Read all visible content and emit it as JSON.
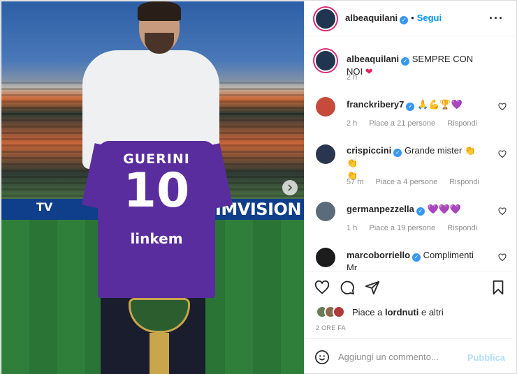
{
  "post": {
    "photo": {
      "shirt_name": "GUERINI",
      "shirt_number": "10",
      "shirt_sponsor": "linkem",
      "banner_text": "TIMVISION",
      "banner_tv": "TV",
      "carousel_next_icon": "chevron-right-icon"
    },
    "header": {
      "username": "albeaquilani",
      "follow_label": "Segui",
      "more_icon": "ellipsis-icon",
      "separator": "•"
    },
    "caption": {
      "username": "albeaquilani",
      "text": "SEMPRE CON NOI",
      "emoji": "❤",
      "time": "2 h"
    },
    "comments": [
      {
        "username": "franckribery7",
        "text": "🙏💪🏆💜",
        "time": "2 h",
        "likes": "Piace a 21 persone",
        "reply": "Rispondi"
      },
      {
        "username": "crispiccini",
        "text": "Grande mister 👏👏",
        "text2": "👏",
        "time": "57 m",
        "likes": "Piace a 4 persone",
        "reply": "Rispondi"
      },
      {
        "username": "germanpezzella",
        "text": "💜💜💜",
        "time": "1 h",
        "likes": "Piace a 19 persone",
        "reply": "Rispondi"
      },
      {
        "username": "marcoborriello",
        "text": "Complimenti Mr",
        "text2": "👏"
      }
    ],
    "likes": {
      "prefix": "Piace a ",
      "user": "lordnuti",
      "suffix": " e altri"
    },
    "posted_time": "2 ORE FA",
    "add_comment": {
      "placeholder": "Aggiungi un commento...",
      "publish_label": "Pubblica"
    },
    "colors": {
      "accent": "#0095f6",
      "verified": "#3897f0",
      "publish_disabled": "#b2dffc"
    }
  }
}
